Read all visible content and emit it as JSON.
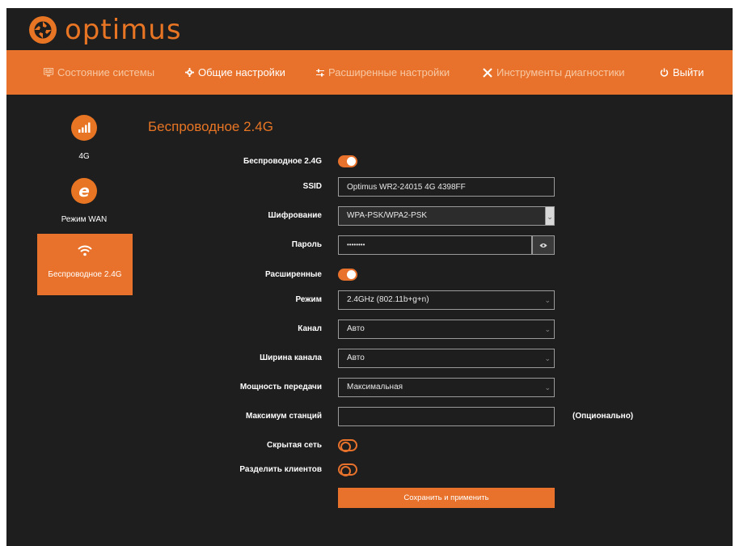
{
  "brand": {
    "logo_text": "optimus",
    "accent_color": "#e8722b"
  },
  "nav": {
    "items": [
      {
        "label": "Состояние системы",
        "icon": "monitor-icon"
      },
      {
        "label": "Общие настройки",
        "icon": "gear-icon"
      },
      {
        "label": "Расширенные настройки",
        "icon": "sliders-icon"
      },
      {
        "label": "Инструменты диагностики",
        "icon": "tools-icon"
      },
      {
        "label": "Выйти",
        "icon": "power-icon"
      }
    ]
  },
  "sidebar": {
    "items": [
      {
        "label": "4G",
        "icon": "signal-bars-icon",
        "active": false
      },
      {
        "label": "Режим WAN",
        "icon": "internet-e-icon",
        "active": false
      },
      {
        "label": "Беспроводное 2.4G",
        "icon": "wifi-icon",
        "active": true
      }
    ]
  },
  "section_title": "Беспроводное 2.4G",
  "form": {
    "wireless_label": "Беспроводное 2.4G",
    "wireless_on": true,
    "ssid_label": "SSID",
    "ssid_value": "Optimus WR2-24015 4G 4398FF",
    "encryption_label": "Шифрование",
    "encryption_value": "WPA-PSK/WPA2-PSK",
    "password_label": "Пароль",
    "password_value": "••••••••",
    "advanced_label": "Расширенные",
    "advanced_on": true,
    "mode_label": "Режим",
    "mode_value": "2.4GHz (802.11b+g+n)",
    "channel_label": "Канал",
    "channel_value": "Авто",
    "bandwidth_label": "Ширина канала",
    "bandwidth_value": "Авто",
    "tx_power_label": "Мощность передачи",
    "tx_power_value": "Максимальная",
    "max_stations_label": "Максимум станций",
    "max_stations_value": "",
    "optional_note": "(Опционально)",
    "hidden_network_label": "Скрытая сеть",
    "hidden_network_on": false,
    "isolate_clients_label": "Разделить клиентов",
    "isolate_clients_on": false,
    "save_label": "Сохранить и применить"
  }
}
